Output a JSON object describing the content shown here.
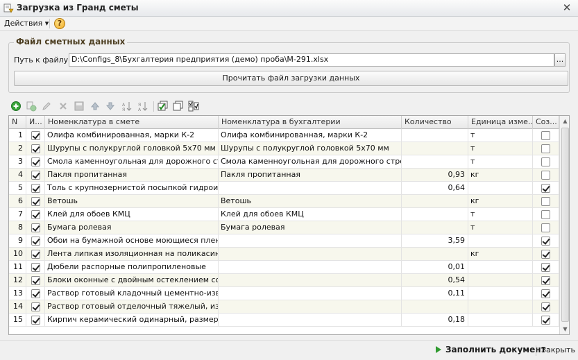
{
  "window": {
    "title": "Загрузка из Гранд сметы"
  },
  "menu": {
    "actions_label": "Действия",
    "actions_arrow": "▾",
    "help_label": "?"
  },
  "file_group": {
    "title": "Файл сметных данных",
    "path_label": "Путь к файлу:",
    "path_value": "D:\\Configs_8\\Бухгалтерия предприятия (демо) проба\\М-291.xlsx",
    "browse_label": "...",
    "read_button_label": "Прочитать файл загрузки данных"
  },
  "toolbar": {
    "icons": [
      "add-icon",
      "copy-icon",
      "edit-icon",
      "delete-icon",
      "save-icon",
      "move-up-icon",
      "move-down-icon",
      "sort-asc-icon",
      "sort-desc-icon",
      "check-all-icon",
      "uncheck-all-icon",
      "toggle-check-icon"
    ]
  },
  "table": {
    "columns": [
      "N",
      "И...",
      "Номенклатура в смете",
      "Номенклатура в бухгалтерии",
      "Количество",
      "Единица изме...",
      "Соз..."
    ],
    "rows": [
      {
        "n": "1",
        "use": true,
        "estimate_item": "Олифа комбинированная, марки К-2",
        "accounting_item": "Олифа комбинированная, марки К-2",
        "qty": "",
        "unit": "т",
        "create": false
      },
      {
        "n": "2",
        "use": true,
        "estimate_item": "Шурупы с полукруглой головкой 5х70 мм",
        "accounting_item": "Шурупы с полукруглой головкой 5х70 мм",
        "qty": "",
        "unit": "т",
        "create": false
      },
      {
        "n": "3",
        "use": true,
        "estimate_item": "Смола каменноугольная для дорожного стро...",
        "accounting_item": "Смола каменноугольная для дорожного строит...",
        "qty": "",
        "unit": "т",
        "create": false
      },
      {
        "n": "4",
        "use": true,
        "estimate_item": "Пакля пропитанная",
        "accounting_item": "Пакля пропитанная",
        "qty": "0,93",
        "unit": "кг",
        "create": false
      },
      {
        "n": "5",
        "use": true,
        "estimate_item": "Толь с крупнозернистой посыпкой гидроизо...",
        "accounting_item": "",
        "qty": "0,64",
        "unit": "",
        "create": true
      },
      {
        "n": "6",
        "use": true,
        "estimate_item": "Ветошь",
        "accounting_item": "Ветошь",
        "qty": "",
        "unit": "кг",
        "create": false
      },
      {
        "n": "7",
        "use": true,
        "estimate_item": "Клей для обоев КМЦ",
        "accounting_item": "Клей для обоев КМЦ",
        "qty": "",
        "unit": "т",
        "create": false
      },
      {
        "n": "8",
        "use": true,
        "estimate_item": "Бумага ролевая",
        "accounting_item": "Бумага ролевая",
        "qty": "",
        "unit": "т",
        "create": false
      },
      {
        "n": "9",
        "use": true,
        "estimate_item": "Обои на бумажной основе моющиеся пленоч...",
        "accounting_item": "",
        "qty": "3,59",
        "unit": "",
        "create": true
      },
      {
        "n": "10",
        "use": true,
        "estimate_item": "Лента липкая изоляционная на поликасинов...",
        "accounting_item": "",
        "qty": "",
        "unit": "кг",
        "create": true
      },
      {
        "n": "11",
        "use": true,
        "estimate_item": "Дюбели распорные полипропиленовые",
        "accounting_item": "",
        "qty": "0,01",
        "unit": "",
        "create": true
      },
      {
        "n": "12",
        "use": true,
        "estimate_item": "Блоки оконные с двойным остеклением со с...",
        "accounting_item": "",
        "qty": "0,54",
        "unit": "",
        "create": true
      },
      {
        "n": "13",
        "use": true,
        "estimate_item": "Раствор готовый кладочный цементно-извес...",
        "accounting_item": "",
        "qty": "0,11",
        "unit": "",
        "create": true
      },
      {
        "n": "14",
        "use": true,
        "estimate_item": "Раствор готовый отделочный тяжелый, изве...",
        "accounting_item": "",
        "qty": "",
        "unit": "",
        "create": true
      },
      {
        "n": "15",
        "use": true,
        "estimate_item": "Кирпич керамический одинарный, размером...",
        "accounting_item": "",
        "qty": "0,18",
        "unit": "",
        "create": true
      }
    ]
  },
  "footer": {
    "fill_label": "Заполнить документ",
    "close_label": "Закрыть"
  },
  "colors": {
    "accent_green": "#2f9a2f",
    "row_alt": "#f7f7ed",
    "group_title": "#4d3f22"
  }
}
